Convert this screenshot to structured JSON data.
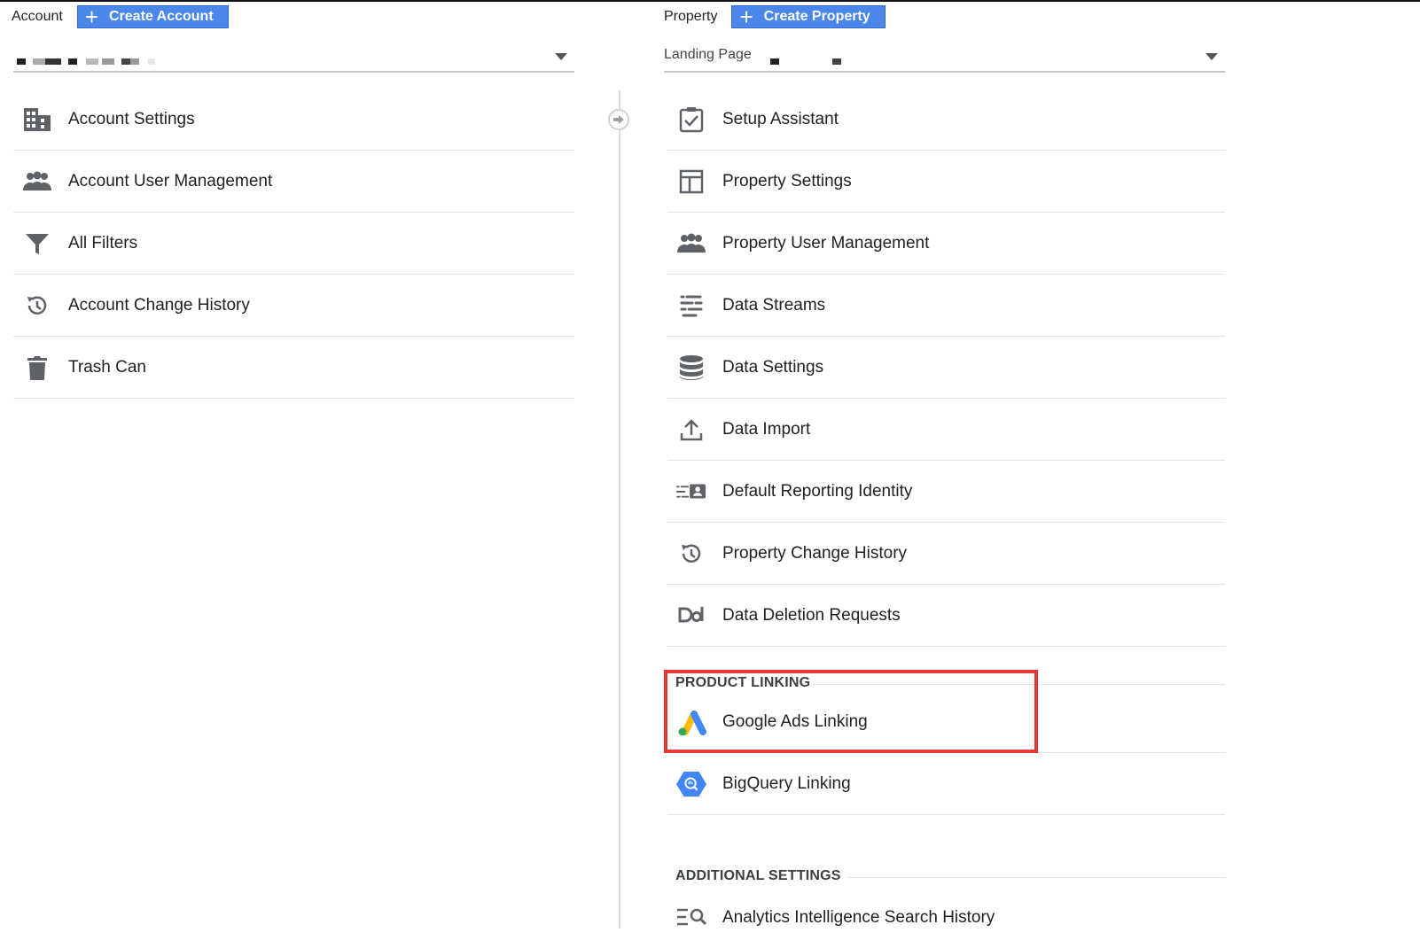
{
  "account": {
    "label": "Account",
    "create_button": "Create Account",
    "menu": [
      {
        "label": "Account Settings",
        "icon": "building-icon"
      },
      {
        "label": "Account User Management",
        "icon": "people-icon"
      },
      {
        "label": "All Filters",
        "icon": "filter-icon"
      },
      {
        "label": "Account Change History",
        "icon": "history-icon"
      },
      {
        "label": "Trash Can",
        "icon": "trash-icon"
      }
    ]
  },
  "property": {
    "label": "Property",
    "create_button": "Create Property",
    "selector_text": "Landing Page",
    "menu": [
      {
        "label": "Setup Assistant",
        "icon": "checklist-icon"
      },
      {
        "label": "Property Settings",
        "icon": "layout-icon"
      },
      {
        "label": "Property User Management",
        "icon": "people-icon"
      },
      {
        "label": "Data Streams",
        "icon": "streams-icon"
      },
      {
        "label": "Data Settings",
        "icon": "database-icon"
      },
      {
        "label": "Data Import",
        "icon": "upload-icon"
      },
      {
        "label": "Default Reporting Identity",
        "icon": "identity-icon"
      },
      {
        "label": "Property Change History",
        "icon": "history-icon"
      },
      {
        "label": "Data Deletion Requests",
        "icon": "dd-icon"
      }
    ],
    "product_linking": {
      "heading": "PRODUCT LINKING",
      "items": [
        {
          "label": "Google Ads Linking",
          "icon": "google-ads-icon"
        },
        {
          "label": "BigQuery Linking",
          "icon": "bigquery-icon"
        }
      ]
    },
    "additional_settings": {
      "heading": "ADDITIONAL SETTINGS",
      "items": [
        {
          "label": "Analytics Intelligence Search History",
          "icon": "search-list-icon"
        }
      ]
    }
  },
  "colors": {
    "button_blue": "#4a87e8",
    "highlight_red": "#e53935",
    "icon_gray": "#5f6368"
  }
}
